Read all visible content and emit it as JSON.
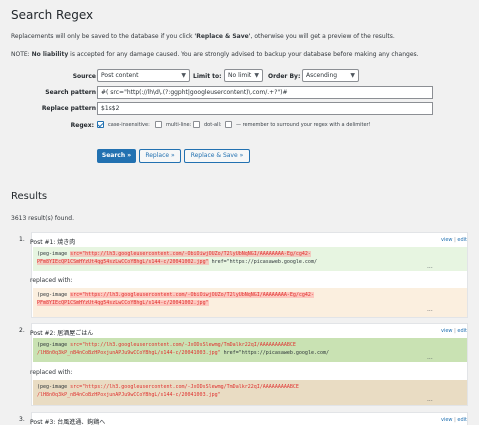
{
  "header": {
    "title": "Search Regex",
    "intro_pre": "Replacements will only be saved to the database if you click ",
    "intro_bold": "'Replace & Save'",
    "intro_post": ", otherwise you will get a preview of the results.",
    "note_label": "NOTE:",
    "note_bold": "No liability",
    "note_text": " is accepted for any damage caused. You are strongly advised to backup your database before making any changes."
  },
  "form": {
    "source_label": "Source",
    "source_value": "Post content",
    "limit_label": "Limit to:",
    "limit_value": "No limit",
    "order_label": "Order By:",
    "order_value": "Ascending",
    "search_label": "Search pattern",
    "search_value": "#( src=\"http(://lh\\d\\.(?:ggpht|googleusercontent)\\.com/.+?\")#",
    "replace_label": "Replace pattern",
    "replace_value": "$1s$2",
    "regex_label": "Regex:",
    "case_label": "case-insensitive:",
    "multiline_label": "multi-line:",
    "dotall_label": "dot-all:",
    "reminder": "— remember to surround your regex with a delimiter!",
    "regex_checked": true
  },
  "buttons": {
    "search": "Search »",
    "replace": "Replace »",
    "replace_save": "Replace & Save »"
  },
  "results": {
    "heading": "Results",
    "count": "3613 result(s) found.",
    "view": "view",
    "sep": "|",
    "edit": "edit",
    "replaced_with": "replaced with:",
    "ellipsis": "...",
    "items": [
      {
        "num": "1.",
        "title": "Post #1: 焼き肉",
        "orig_pre": "(peg-image ",
        "orig_src_1": "src=\"http://lh3.googleusercontent.com/-ObiOiwjOUZo/T2lyUbNqNGI/AAAAAAAA-Eg/cg42-",
        "orig_src_2": "PFm8YIEcQP1CSmHYzUt4qg54szLwCCoYBhgL/s144-c/20041002.jpg\"",
        "orig_post": " href=\"https://picasaweb.google.com/",
        "new_pre": "(peg-image ",
        "new_src_1": "src=\"https://lh3.googleusercontent.com/-ObiOiwjOUZo/T2lyUbNqNGI/AAAAAAAA-Eg/cg42-",
        "new_src_2": "PFm8YIEcQP1CSmHYzUt4qg54szLwCCoYBhgL/s144-c/20041002.jpg\"",
        "new_post": " href=\"https://picasaweb.google.com/"
      },
      {
        "num": "2.",
        "title": "Post #2: 居酒屋ごはん",
        "orig_pre": "(peg-image ",
        "orig_src_1": "src=\"http://lh3.googleusercontent.com/-JxODsSlewmg/TmDalkr22qI/AAAAAAAAABCE",
        "orig_src_2": "/lH8n0q3kP_nB4nCoBzHPoxjunAPJu9wCCoYBhgL/s144-c/20041003.jpg\"",
        "orig_post": " href=\"https://picasaweb.google.com/",
        "new_pre": "(peg-image ",
        "new_src_1": "src=\"https://lh3.googleusercontent.com/-JxODsSlewmg/TmDalkr22qI/AAAAAAAAABCE",
        "new_src_2": "/lH8n0q3kP_nB4nCoBzHPoxjunAPJu9wCCoYBhgL/s144-c/20041003.jpg\"",
        "new_post": " href=\"https://picasaweb.google.com/"
      },
      {
        "num": "3.",
        "title": "Post #3: 台風進通、鉤鶏へ"
      }
    ]
  },
  "colors": {
    "primary": "#2271b1",
    "match_green_light": "#e7f5e1",
    "match_peach": "#fbefdf",
    "match_green": "#c9e2b3",
    "match_tan": "#e9dcc3",
    "highlight_red": "#e0312f"
  }
}
